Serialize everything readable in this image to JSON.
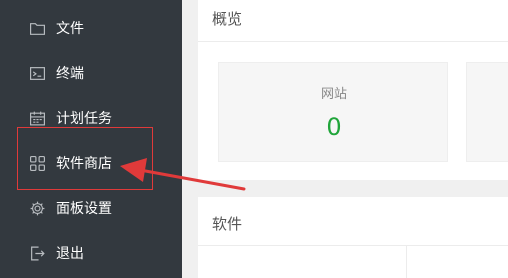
{
  "sidebar": {
    "items": [
      {
        "label": "文件",
        "icon": "folder-icon"
      },
      {
        "label": "终端",
        "icon": "terminal-icon"
      },
      {
        "label": "计划任务",
        "icon": "calendar-icon"
      },
      {
        "label": "软件商店",
        "icon": "grid-icon"
      },
      {
        "label": "面板设置",
        "icon": "gear-icon"
      },
      {
        "label": "退出",
        "icon": "logout-icon"
      }
    ]
  },
  "main": {
    "overview": {
      "title": "概览",
      "cards": [
        {
          "label": "网站",
          "value": "0"
        }
      ]
    },
    "software": {
      "title": "软件"
    }
  },
  "colors": {
    "sidebar_bg": "#33393f",
    "accent_green": "#20a53a",
    "annotation_red": "#e03a3a"
  }
}
